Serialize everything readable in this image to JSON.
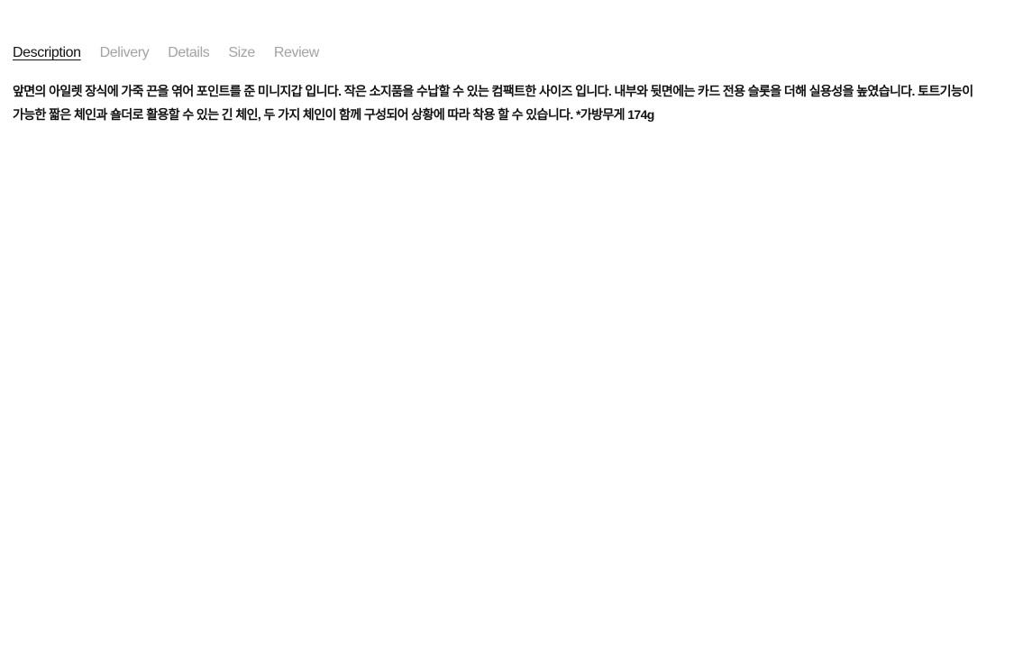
{
  "tabs": [
    {
      "label": "Description",
      "active": true
    },
    {
      "label": "Delivery",
      "active": false
    },
    {
      "label": "Details",
      "active": false
    },
    {
      "label": "Size",
      "active": false
    },
    {
      "label": "Review",
      "active": false
    }
  ],
  "description": {
    "text": "앞면의 아일렛 장식에 가죽 끈을 엮어 포인트를 준 미니지갑 입니다. 작은 소지품을 수납할 수 있는 컴팩트한 사이즈 입니다. 내부와 뒷면에는 카드 전용 슬롯을 더해 실용성을 높였습니다. 토트기능이 가능한 짧은 체인과 숄더로 활용할 수 있는 긴 체인, 두 가지 체인이 함께 구성되어 상황에 따라 착용 할 수 있습니다. *가방무게 174g"
  },
  "colors": {
    "active_tab": "#111111",
    "inactive_tab": "#a3a3a3",
    "body_text": "#111111",
    "background": "#ffffff"
  }
}
